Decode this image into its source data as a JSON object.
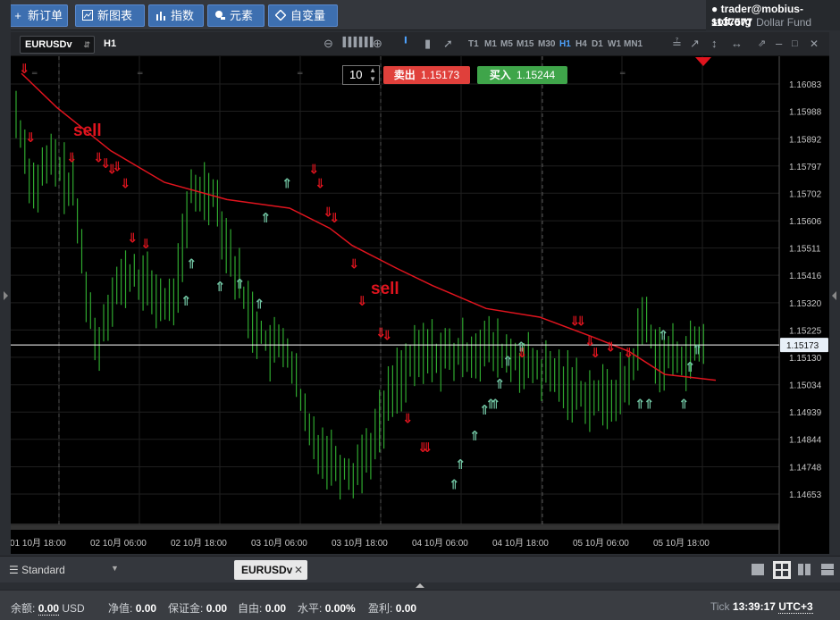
{
  "toolbar": {
    "new_order": "新订单",
    "new_chart": "新图表",
    "indicators": "指数",
    "elements": "元素",
    "variables": "自变量"
  },
  "account": {
    "email": "trader@mobius-soft.org",
    "number": "1137577",
    "fund": "Dollar Fund"
  },
  "chart_toolbar": {
    "symbol": "EURUSDv",
    "timeframe": "H1",
    "timeframes": [
      "T1",
      "M1",
      "M5",
      "M15",
      "M30",
      "H1",
      "H4",
      "D1",
      "W1",
      "MN1"
    ],
    "active_timeframe": "H1"
  },
  "trade_panel": {
    "quantity": "10",
    "sell_label": "卖出",
    "sell_price": "1.15173",
    "buy_label": "买入",
    "buy_price": "1.15244"
  },
  "chart_data": {
    "type": "ohlc",
    "symbol": "EURUSDv",
    "timeframe": "H1",
    "current_price": "1.15173",
    "y_ticks": [
      "1.16083",
      "1.15988",
      "1.15892",
      "1.15797",
      "1.15702",
      "1.15606",
      "1.15511",
      "1.15416",
      "1.15320",
      "1.15225",
      "1.15130",
      "1.15034",
      "1.14939",
      "1.14844",
      "1.14748",
      "1.14653"
    ],
    "x_ticks": [
      "01 10月 18:00",
      "02 10月 06:00",
      "02 10月 18:00",
      "03 10月 06:00",
      "03 10月 18:00",
      "04 10月 06:00",
      "04 10月 18:00",
      "05 10月 06:00",
      "05 10月 18:00"
    ],
    "annotations": [
      "sell",
      "sell"
    ],
    "colors": {
      "bars": "#2fa82f",
      "moving_average": "#e0141e",
      "sell_signal": "#e0141e",
      "buy_signal": "#6fc2a0",
      "price_line": "#ffffff"
    }
  },
  "tabs": {
    "layout": "Standard",
    "chart_tab": "EURUSDv",
    "close": "✕"
  },
  "status": {
    "balance_label": "余额:",
    "balance_value": "0.00",
    "balance_currency": "USD",
    "equity_label": "净值:",
    "equity_value": "0.00",
    "margin_label": "保证金:",
    "margin_value": "0.00",
    "free_label": "自由:",
    "free_value": "0.00",
    "level_label": "水平:",
    "level_value": "0.00%",
    "profit_label": "盈利:",
    "profit_value": "0.00",
    "tick_label": "Tick",
    "time": "13:39:17",
    "timezone": "UTC+3"
  }
}
